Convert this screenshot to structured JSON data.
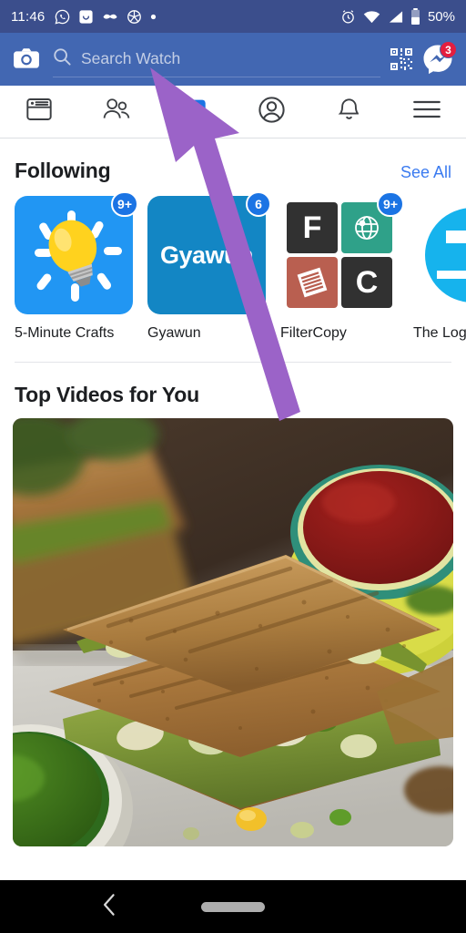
{
  "status_bar": {
    "time": "11:46",
    "battery_percent": "50%",
    "left_icons": [
      "whatsapp-icon",
      "smiley-box-icon",
      "moustache-icon",
      "aperture-icon",
      "dot-icon"
    ],
    "right_icons": [
      "alarm-icon",
      "wifi-icon",
      "signal-icon",
      "battery-icon"
    ],
    "background_color": "#3b4e8c"
  },
  "header": {
    "background_color": "#4267b2",
    "camera_icon": "camera-icon",
    "search": {
      "placeholder": "Search Watch",
      "value": "",
      "icon": "search-icon"
    },
    "qr_icon": "qr-code-icon",
    "messenger": {
      "icon": "messenger-icon",
      "badge": "3",
      "badge_color": "#e41e3f"
    }
  },
  "tabs": [
    {
      "name": "news-feed",
      "icon": "news-feed-icon",
      "active": false
    },
    {
      "name": "friends",
      "icon": "friends-icon",
      "active": false
    },
    {
      "name": "watch",
      "icon": "watch-icon",
      "active": true
    },
    {
      "name": "profile",
      "icon": "profile-icon",
      "active": false
    },
    {
      "name": "notifications",
      "icon": "bell-icon",
      "active": false
    },
    {
      "name": "menu",
      "icon": "hamburger-menu-icon",
      "active": false
    }
  ],
  "following": {
    "title": "Following",
    "see_all_label": "See All",
    "see_all_color": "#3b7bf0",
    "pages": [
      {
        "label": "5-Minute Crafts",
        "badge": "9+",
        "art": "lightbulb-on-blue"
      },
      {
        "label": "Gyawun",
        "badge": "6",
        "art": "gyawun-wordmark",
        "wordmark": "Gyawun"
      },
      {
        "label": "FilterCopy",
        "badge": "9+",
        "art": "filtercopy-quad",
        "quad": [
          "F",
          "globe",
          "document",
          "C"
        ]
      },
      {
        "label": "The Logic",
        "badge": "",
        "art": "logical-indian-circle"
      }
    ]
  },
  "top_videos": {
    "title": "Top Videos for You",
    "video": {
      "thumbnail_description": "grilled-green-chutney-sandwich-photo",
      "alt": "Stacked grilled sandwich with green chutney filling, yellow bowl of red sauce, bowl of green chutney"
    }
  },
  "system_nav": {
    "back_icon": "back-chevron-icon",
    "home_indicator": "home-pill-indicator",
    "background_color": "#000000"
  },
  "annotation": {
    "arrow": {
      "name": "purple-arrow-annotation",
      "color": "#9b63c8",
      "points_to": "Search Watch field"
    }
  }
}
